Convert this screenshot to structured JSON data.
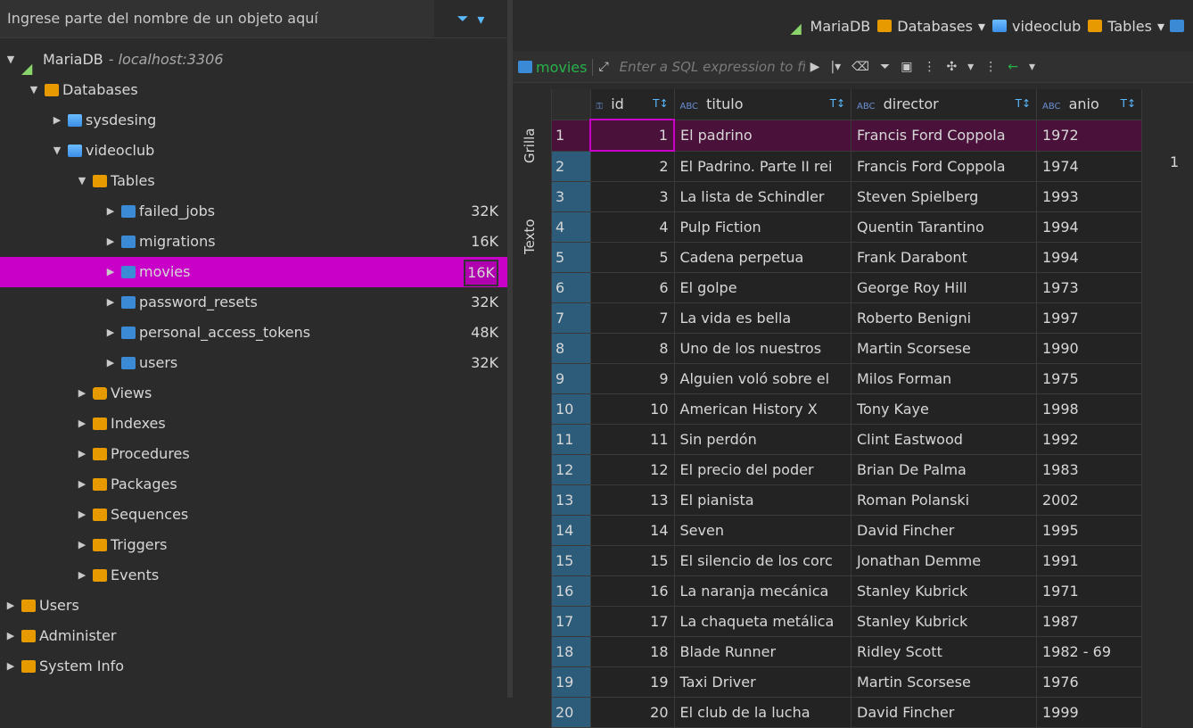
{
  "left": {
    "filter_placeholder": "Ingrese parte del nombre de un objeto aquí",
    "tree": {
      "connection": {
        "name": "MariaDB",
        "suffix": "- localhost:3306"
      },
      "databases_label": "Databases",
      "databases": [
        {
          "name": "sysdesing",
          "expanded": false
        },
        {
          "name": "videoclub",
          "expanded": true
        }
      ],
      "tables_label": "Tables",
      "tables": [
        {
          "name": "failed_jobs",
          "size": "32K"
        },
        {
          "name": "migrations",
          "size": "16K"
        },
        {
          "name": "movies",
          "size": "16K"
        },
        {
          "name": "password_resets",
          "size": "32K"
        },
        {
          "name": "personal_access_tokens",
          "size": "48K"
        },
        {
          "name": "users",
          "size": "32K"
        }
      ],
      "groups": [
        "Views",
        "Indexes",
        "Procedures",
        "Packages",
        "Sequences",
        "Triggers",
        "Events"
      ],
      "root_items": [
        "Users",
        "Administer",
        "System Info"
      ]
    }
  },
  "topbar": {
    "crumbs": [
      "MariaDB",
      "Databases",
      "videoclub",
      "Tables"
    ]
  },
  "toolbar": {
    "tab_label": "movies",
    "sql_placeholder": "Enter a SQL expression to filter results"
  },
  "side_tabs": {
    "grilla": "Grilla",
    "texto": "Texto"
  },
  "grid": {
    "headers": {
      "id": "id",
      "titulo": "titulo",
      "director": "director",
      "anio": "anio"
    },
    "rows": [
      {
        "n": "1",
        "id": "1",
        "titulo": "El padrino",
        "director": "Francis Ford Coppola",
        "anio": "1972"
      },
      {
        "n": "2",
        "id": "2",
        "titulo": "El Padrino. Parte II rei",
        "director": "Francis Ford Coppola",
        "anio": "1974"
      },
      {
        "n": "3",
        "id": "3",
        "titulo": "La lista de Schindler",
        "director": "Steven Spielberg",
        "anio": "1993"
      },
      {
        "n": "4",
        "id": "4",
        "titulo": "Pulp Fiction",
        "director": "Quentin Tarantino",
        "anio": "1994"
      },
      {
        "n": "5",
        "id": "5",
        "titulo": "Cadena perpetua",
        "director": "Frank Darabont",
        "anio": "1994"
      },
      {
        "n": "6",
        "id": "6",
        "titulo": "El golpe",
        "director": "George Roy Hill",
        "anio": "1973"
      },
      {
        "n": "7",
        "id": "7",
        "titulo": "La vida es bella",
        "director": "Roberto Benigni",
        "anio": "1997"
      },
      {
        "n": "8",
        "id": "8",
        "titulo": "Uno de los nuestros",
        "director": "Martin Scorsese",
        "anio": "1990"
      },
      {
        "n": "9",
        "id": "9",
        "titulo": "Alguien voló sobre el",
        "director": "Milos Forman",
        "anio": "1975"
      },
      {
        "n": "10",
        "id": "10",
        "titulo": "American History X",
        "director": "Tony Kaye",
        "anio": "1998"
      },
      {
        "n": "11",
        "id": "11",
        "titulo": "Sin perdón",
        "director": "Clint Eastwood",
        "anio": "1992"
      },
      {
        "n": "12",
        "id": "12",
        "titulo": "El precio del poder",
        "director": "Brian De Palma",
        "anio": "1983"
      },
      {
        "n": "13",
        "id": "13",
        "titulo": "El pianista",
        "director": "Roman Polanski",
        "anio": "2002"
      },
      {
        "n": "14",
        "id": "14",
        "titulo": "Seven",
        "director": "David Fincher",
        "anio": "1995"
      },
      {
        "n": "15",
        "id": "15",
        "titulo": "El silencio de los corc",
        "director": "Jonathan Demme",
        "anio": "1991"
      },
      {
        "n": "16",
        "id": "16",
        "titulo": "La naranja mecánica",
        "director": "Stanley Kubrick",
        "anio": "1971"
      },
      {
        "n": "17",
        "id": "17",
        "titulo": "La chaqueta metálica",
        "director": "Stanley Kubrick",
        "anio": "1987"
      },
      {
        "n": "18",
        "id": "18",
        "titulo": "Blade Runner",
        "director": "Ridley Scott",
        "anio": "1982 - 69"
      },
      {
        "n": "19",
        "id": "19",
        "titulo": "Taxi Driver",
        "director": "Martin Scorsese",
        "anio": "1976"
      },
      {
        "n": "20",
        "id": "20",
        "titulo": "El club de la lucha",
        "director": "David Fincher",
        "anio": "1999"
      }
    ]
  },
  "right_edge": {
    "label": "1"
  }
}
